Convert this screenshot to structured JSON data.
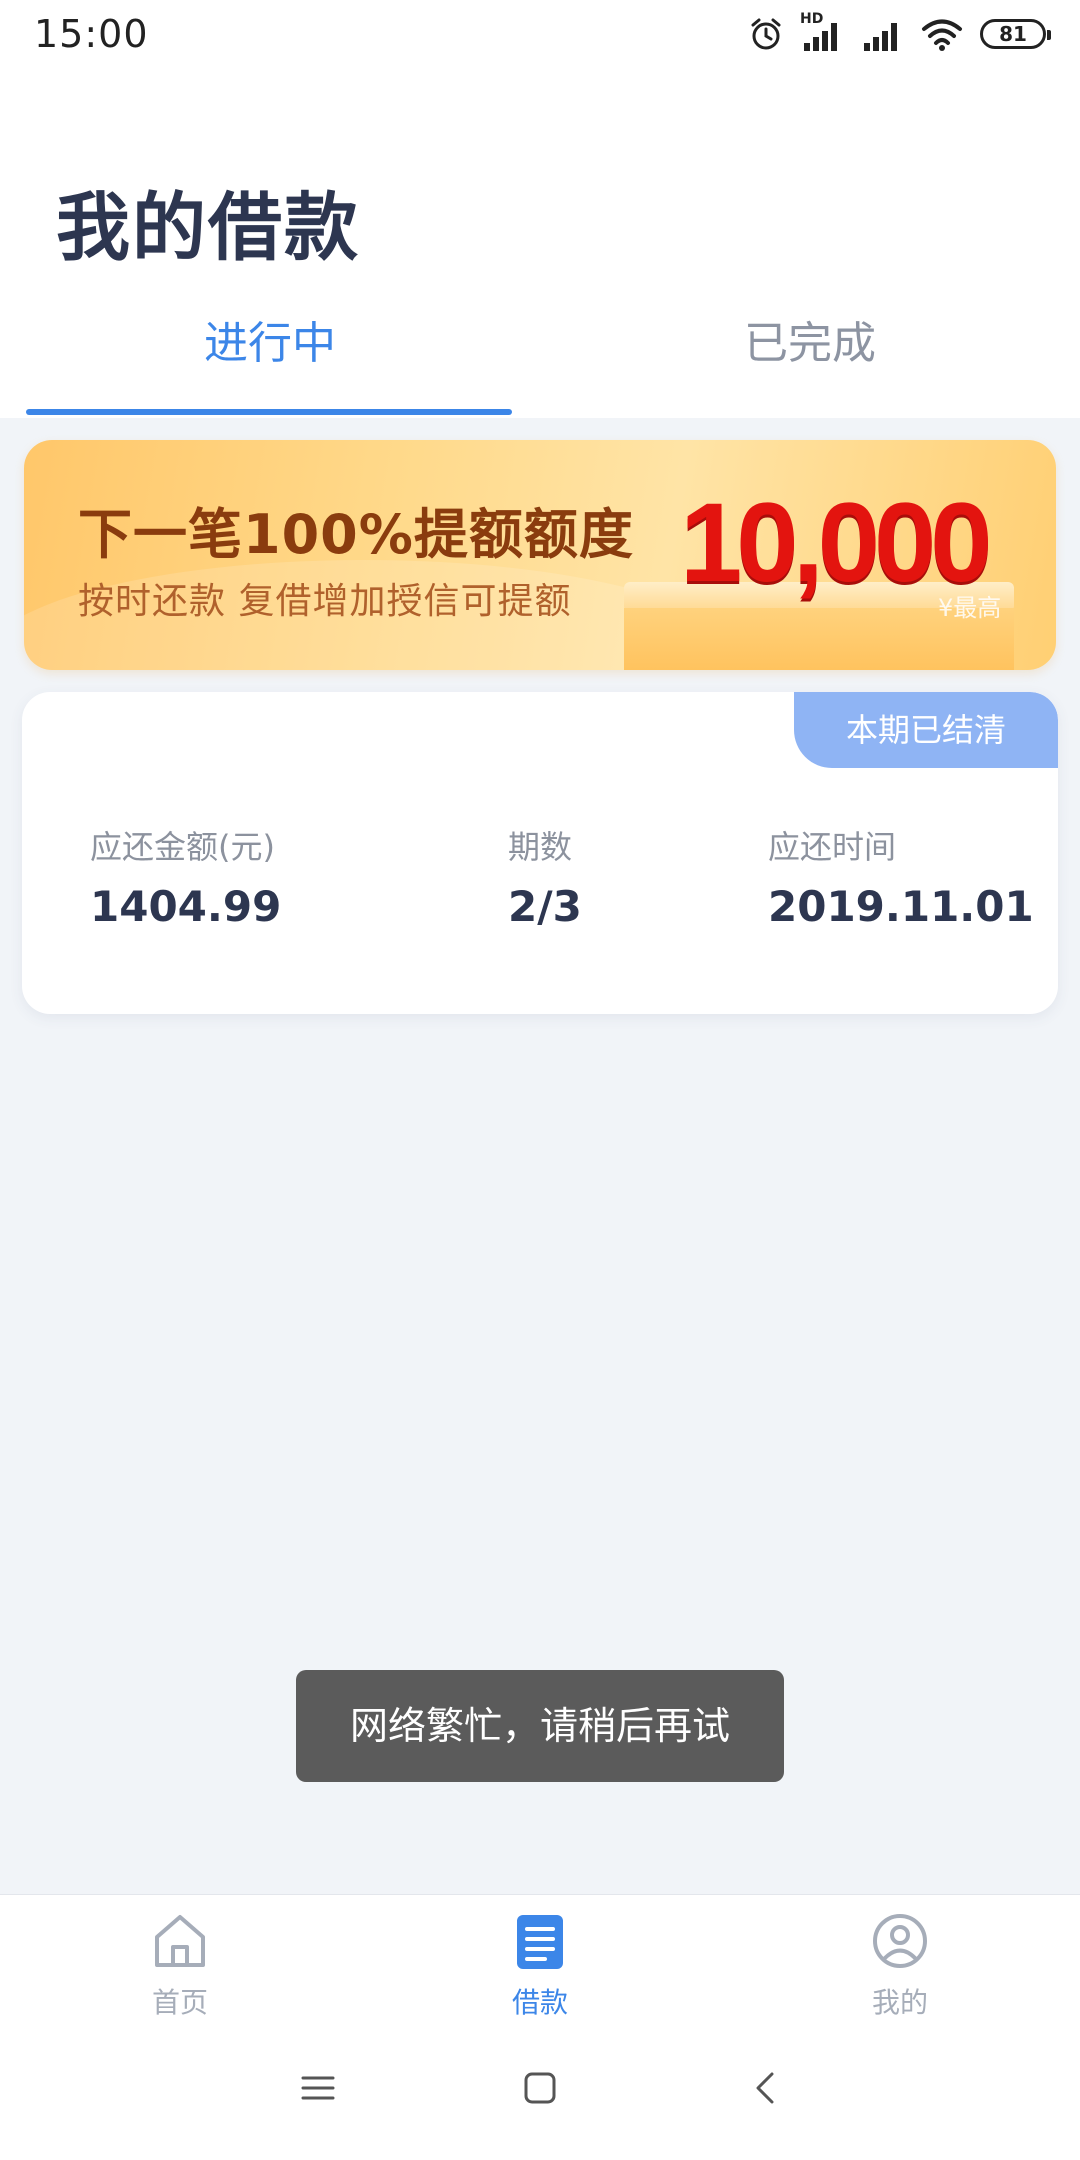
{
  "status_bar": {
    "time": "15:00",
    "network_tag": "HD",
    "battery": "81"
  },
  "header": {
    "title": "我的借款",
    "tabs": [
      {
        "label": "进行中",
        "active": true
      },
      {
        "label": "已完成",
        "active": false
      }
    ]
  },
  "banner": {
    "headline": "下一笔100%提额额度",
    "subline": "按时还款  复借增加授信可提额",
    "amount": "10,000",
    "amount_note": "¥最高",
    "colors": {
      "amount": "#e3140f",
      "headline": "#8a3c0e"
    }
  },
  "loan_card": {
    "badge": "本期已结清",
    "fields": [
      {
        "label": "应还金额(元)",
        "value": "1404.99"
      },
      {
        "label": "期数",
        "value": "2/3"
      },
      {
        "label": "应还时间",
        "value": "2019.11.01"
      }
    ]
  },
  "toast": {
    "message": "网络繁忙，请稍后再试"
  },
  "bottom_nav": {
    "items": [
      {
        "label": "首页",
        "icon": "home-icon",
        "active": false
      },
      {
        "label": "借款",
        "icon": "loan-document-icon",
        "active": true
      },
      {
        "label": "我的",
        "icon": "user-profile-icon",
        "active": false
      }
    ],
    "accent": "#3c86e8"
  },
  "system_nav": {
    "icons": [
      "menu-icon",
      "home-square-icon",
      "back-icon"
    ]
  }
}
